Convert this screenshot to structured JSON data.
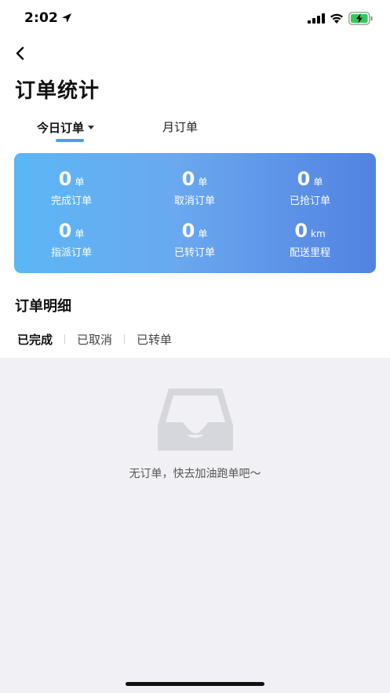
{
  "status_bar": {
    "time": "2:02",
    "icons": [
      "location-arrow-icon",
      "signal-icon",
      "wifi-icon",
      "battery-charging-icon"
    ]
  },
  "nav": {
    "back_icon": "chevron-left-icon",
    "title": "订单统计"
  },
  "tabs": {
    "today_label": "今日订单",
    "month_label": "月订单",
    "active": "today",
    "accent_color": "#4aa0ea"
  },
  "stats": {
    "gradient_colors": [
      "#5bb7f5",
      "#5282e2"
    ],
    "items": [
      {
        "value": "0",
        "unit": "单",
        "label": "完成订单"
      },
      {
        "value": "0",
        "unit": "单",
        "label": "取消订单"
      },
      {
        "value": "0",
        "unit": "单",
        "label": "已抢订单"
      },
      {
        "value": "0",
        "unit": "单",
        "label": "指派订单"
      },
      {
        "value": "0",
        "unit": "单",
        "label": "已转订单"
      },
      {
        "value": "0",
        "unit": "km",
        "label": "配送里程"
      }
    ]
  },
  "details": {
    "title": "订单明细",
    "tabs": [
      "已完成",
      "已取消",
      "已转单"
    ],
    "active_tab": "已完成"
  },
  "empty_state": {
    "icon": "empty-inbox-icon",
    "text": "无订单，快去加油跑单吧～"
  }
}
